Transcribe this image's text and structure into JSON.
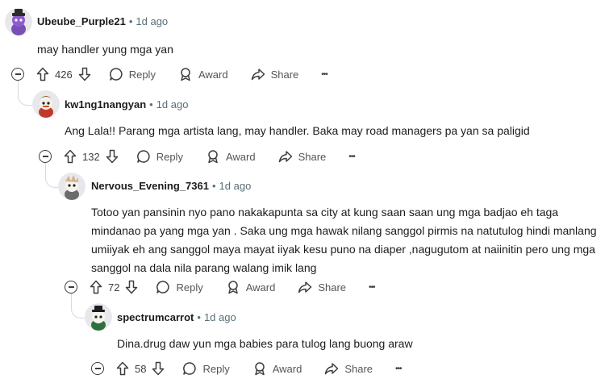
{
  "comments": [
    {
      "username": "Ubeube_Purple21",
      "time": "1d ago",
      "body": "may handler yung mga yan",
      "votes": "426"
    },
    {
      "username": "kw1ng1nangyan",
      "time": "1d ago",
      "body": "Ang Lala!! Parang mga artista lang, may handler. Baka may road managers pa yan sa paligid",
      "votes": "132"
    },
    {
      "username": "Nervous_Evening_7361",
      "time": "1d ago",
      "body": "Totoo yan pansinin nyo pano nakakapunta sa city at kung saan saan ung mga badjao eh taga mindanao pa yang mga yan . Saka ung mga hawak nilang sanggol pirmis na natutulog hindi manlang umiiyak eh ang sanggol maya mayat iiyak kesu puno na diaper ,nagugutom at naiinitin pero ung mga sanggol na dala nila parang walang imik lang",
      "votes": "72"
    },
    {
      "username": "spectrumcarrot",
      "time": "1d ago",
      "body": "Dina.drug daw yun mga babies para tulog lang buong araw",
      "votes": "58"
    }
  ],
  "actions": {
    "reply": "Reply",
    "award": "Award",
    "share": "Share",
    "more": "•••"
  },
  "separator": "•"
}
